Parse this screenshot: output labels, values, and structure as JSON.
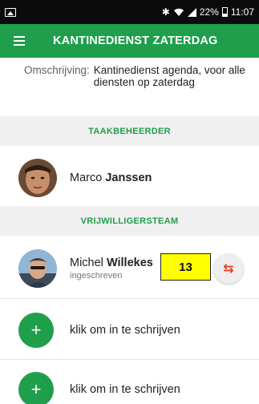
{
  "status_bar": {
    "battery_percent": "22%",
    "time": "11:07",
    "icons": [
      "gallery-icon",
      "bluetooth-icon",
      "wifi-icon",
      "signal-icon",
      "battery-icon"
    ]
  },
  "app_bar": {
    "title": "KANTINEDIENST ZATERDAG",
    "menu_icon": "hamburger-menu-icon"
  },
  "description": {
    "label": "Omschrijving:",
    "value": "Kantinedienst agenda, voor alle diensten op zaterdag"
  },
  "sections": {
    "task_manager": {
      "header": "TAAKBEHEERDER",
      "person": {
        "first_name": "Marco",
        "last_name": "Janssen"
      }
    },
    "volunteers": {
      "header": "VRIJWILLIGERSTEAM",
      "person": {
        "first_name": "Michel",
        "last_name": "Willekes",
        "status": "ingeschreven"
      },
      "badge": "13",
      "swap_icon": "swap-arrows-icon"
    }
  },
  "signup_slots": [
    {
      "label": "klik om in te schrijven"
    },
    {
      "label": "klik om in te schrijven"
    }
  ],
  "colors": {
    "primary_green": "#1f9e4b",
    "badge_yellow": "#ffff00",
    "swap_red": "#e0412b"
  }
}
